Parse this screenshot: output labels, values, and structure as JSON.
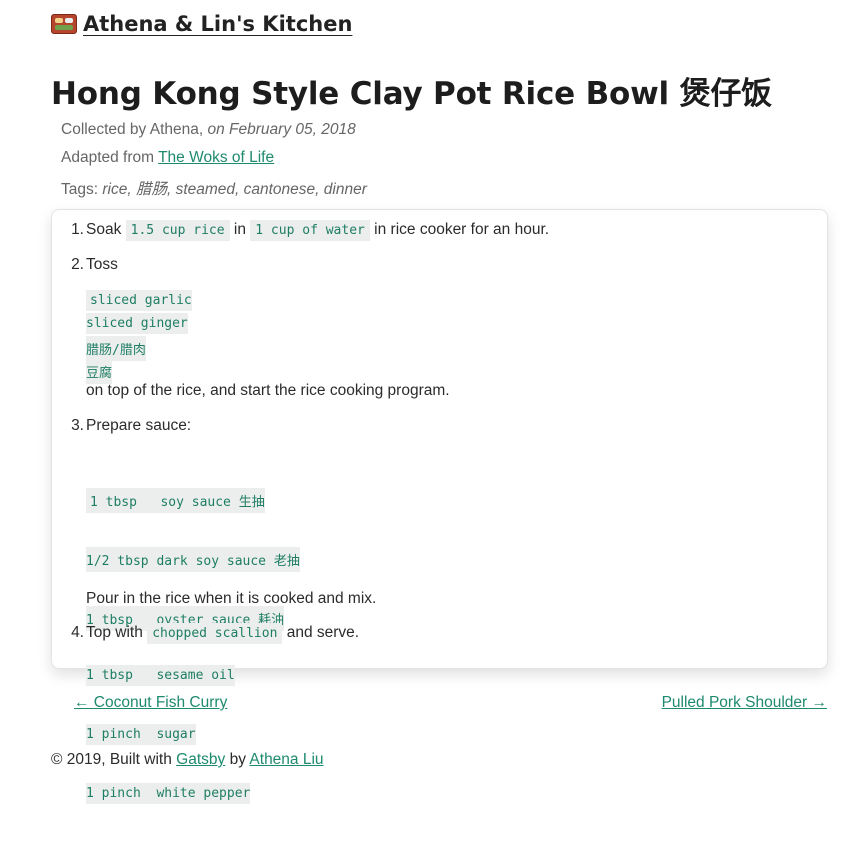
{
  "site": {
    "title": "Athena & Lin's Kitchen",
    "icon": "bento-box-icon"
  },
  "post": {
    "title": "Hong Kong Style Clay Pot Rice Bowl 煲仔饭",
    "collected_prefix": "Collected by Athena,",
    "collected_date": "on February 05, 2018",
    "adapted_prefix": "Adapted from",
    "adapted_link": "The Woks of Life",
    "tags_prefix": "Tags:",
    "tags": "rice, 腊肠, steamed, cantonese, dinner"
  },
  "steps": [
    {
      "num": "1.",
      "t1": "Soak",
      "c1": "1.5 cup rice",
      "t2": "in",
      "c2": "1 cup of water",
      "t3": "in rice cooker for an hour."
    },
    {
      "num": "2.",
      "intro": "Toss",
      "code": [
        "sliced garlic",
        "sliced ginger",
        "腊肠/腊肉",
        "豆腐"
      ],
      "outro": "on top of the rice, and start the rice cooking program."
    },
    {
      "num": "3.",
      "intro": "Prepare sauce:",
      "code": [
        "1 tbsp   soy sauce 生抽",
        "1/2 tbsp dark soy sauce 老抽",
        "1 tbsp   oyster sauce 耗油",
        "1 tbsp   sesame oil",
        "1 pinch  sugar",
        "1 pinch  white pepper"
      ],
      "outro": "Pour in the rice when it is cooked and mix."
    },
    {
      "num": "4.",
      "t1": "Top with",
      "c1": "chopped scallion",
      "t2": "and serve."
    }
  ],
  "nav": {
    "prev": "← Coconut Fish Curry",
    "next": "Pulled Pork Shoulder →"
  },
  "footer": {
    "prefix": "© 2019, Built with",
    "gatsby": "Gatsby",
    "by": "by",
    "author": "Athena Liu"
  },
  "colors": {
    "link": "#1e8a6e",
    "code_text": "#1e7e63",
    "code_bg": "#eceeee"
  }
}
